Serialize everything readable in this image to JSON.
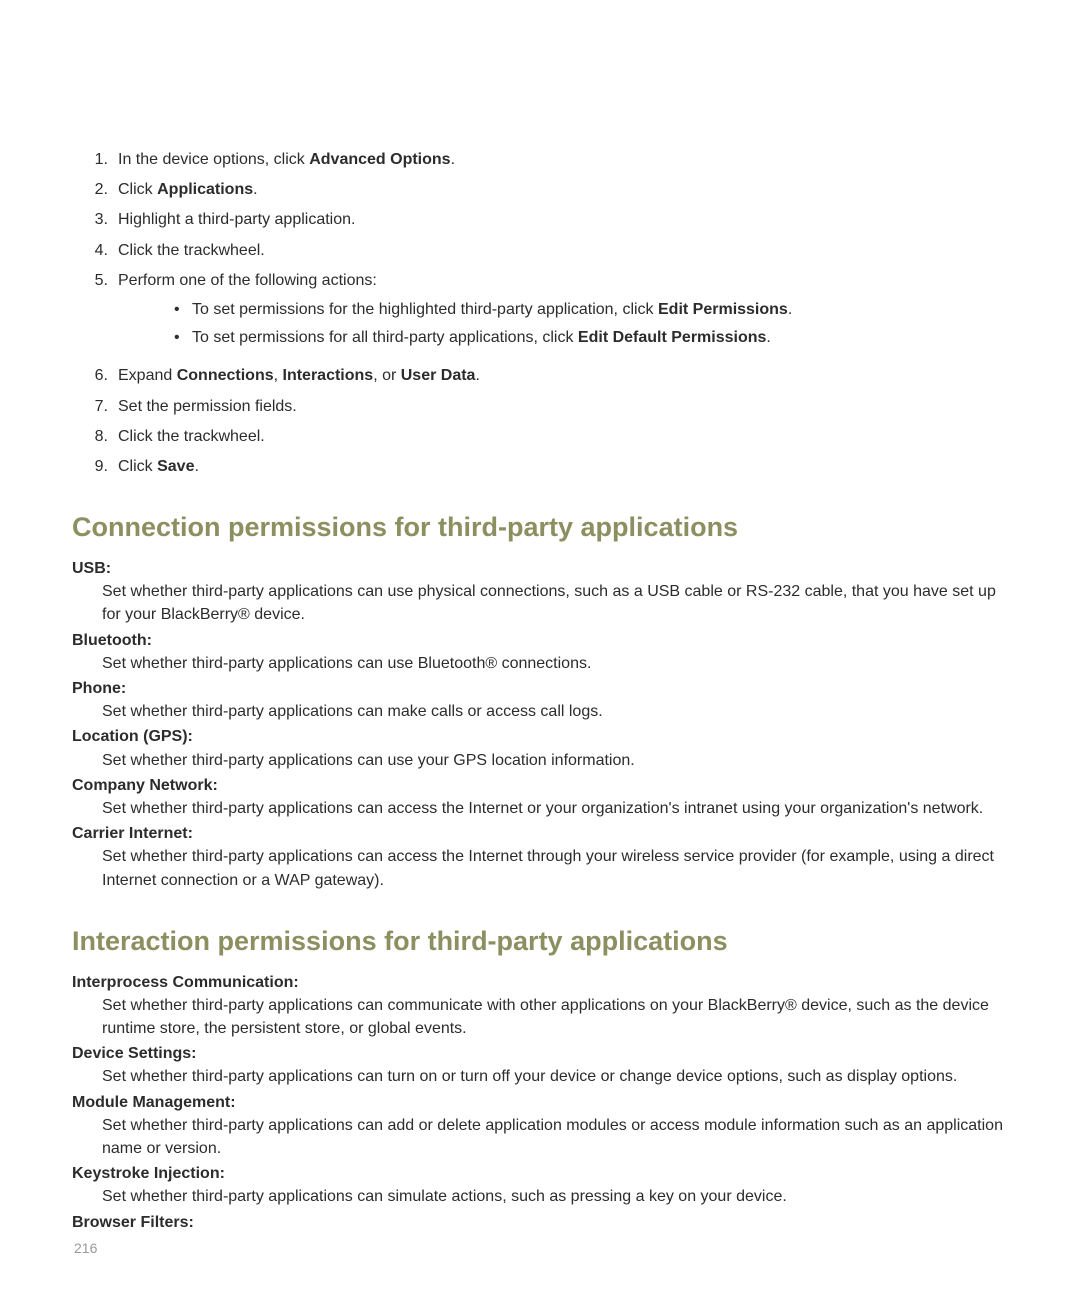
{
  "steps": [
    {
      "num": "1.",
      "prefix": "In the device options, click ",
      "bold": "Advanced Options",
      "suffix": "."
    },
    {
      "num": "2.",
      "prefix": "Click ",
      "bold": "Applications",
      "suffix": "."
    },
    {
      "num": "3.",
      "text": "Highlight a third-party application."
    },
    {
      "num": "4.",
      "text": "Click the trackwheel."
    },
    {
      "num": "5.",
      "text": "Perform one of the following actions:"
    },
    {
      "num": "6.",
      "prefix": "Expand ",
      "bold_parts": [
        "Connections",
        "Interactions",
        "User Data"
      ],
      "joins": [
        ", ",
        ", or "
      ],
      "suffix": "."
    },
    {
      "num": "7.",
      "text": "Set the permission fields."
    },
    {
      "num": "8.",
      "text": "Click the trackwheel."
    },
    {
      "num": "9.",
      "prefix": "Click ",
      "bold": "Save",
      "suffix": "."
    }
  ],
  "bullets": [
    {
      "prefix": "To set permissions for the highlighted third-party application, click ",
      "bold": "Edit Permissions",
      "suffix": "."
    },
    {
      "prefix": "To set permissions for all third-party applications, click ",
      "bold": "Edit Default Permissions",
      "suffix": "."
    }
  ],
  "section1": {
    "heading": "Connection permissions for third-party applications",
    "items": [
      {
        "term": "USB:",
        "desc": "Set whether third-party applications can use physical connections, such as a USB cable or RS-232 cable, that you have set up for your BlackBerry® device."
      },
      {
        "term": "Bluetooth:",
        "desc": "Set whether third-party applications can use Bluetooth® connections."
      },
      {
        "term": "Phone:",
        "desc": "Set whether third-party applications can make calls or access call logs."
      },
      {
        "term": "Location (GPS):",
        "desc": "Set whether third-party applications can use your GPS location information."
      },
      {
        "term": "Company Network:",
        "desc": "Set whether third-party applications can access the Internet or your organization's intranet using your organization's network."
      },
      {
        "term": "Carrier Internet:",
        "desc": "Set whether third-party applications can access the Internet through your wireless service provider (for example, using a direct Internet connection or a WAP gateway)."
      }
    ]
  },
  "section2": {
    "heading": "Interaction permissions for third-party applications",
    "items": [
      {
        "term": "Interprocess Communication:",
        "desc": "Set whether third-party applications can communicate with other applications on your BlackBerry® device, such as the device runtime store, the persistent store, or global events."
      },
      {
        "term": "Device Settings:",
        "desc": "Set whether third-party applications can turn on or turn off your device or change device options, such as display options."
      },
      {
        "term": "Module Management:",
        "desc": "Set whether third-party applications can add or delete application modules or access module information such as an application name or version."
      },
      {
        "term": "Keystroke Injection:",
        "desc": "Set whether third-party applications can simulate actions, such as pressing a key on your device."
      },
      {
        "term": "Browser Filters:",
        "desc": ""
      }
    ]
  },
  "pageNumber": "216"
}
